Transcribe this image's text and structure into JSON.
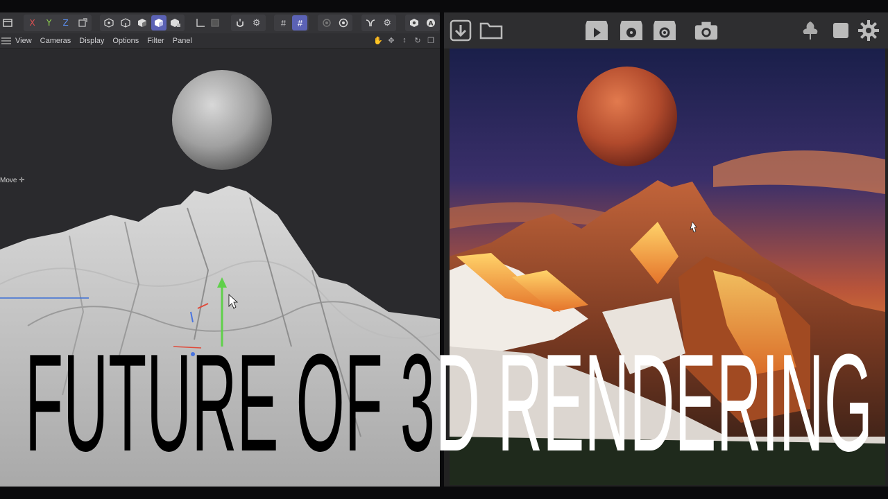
{
  "editor": {
    "toolbar": {
      "axis_x": "X",
      "axis_y": "Y",
      "axis_z": "Z",
      "icons": [
        "panel-icon",
        "coordinate-icon",
        "points-mode-icon",
        "edges-mode-icon",
        "polygons-mode-icon",
        "model-mode-icon",
        "texture-mode-icon",
        "workplane-icon",
        "snap-icon",
        "lock-icon",
        "gear-icon",
        "grid-icon",
        "grid-snap-icon",
        "solo-icon",
        "target-icon",
        "symmetry-icon",
        "settings-icon",
        "object-icon",
        "auto-icon"
      ]
    },
    "menu": {
      "items": [
        "View",
        "Cameras",
        "Display",
        "Options",
        "Filter",
        "Panel"
      ]
    },
    "viewport": {
      "tool_label": "Move"
    }
  },
  "render_window": {
    "toolbar_icons": [
      "download-icon",
      "folder-icon",
      "render-play-icon",
      "render-reel-icon",
      "render-settings-icon",
      "camera-icon",
      "tree-icon",
      "stop-icon",
      "gear-icon"
    ]
  },
  "headline": {
    "text": "FUTURE OF 3D RENDERING"
  },
  "colors": {
    "accent": "#5b62b5",
    "editor_bg": "#2b2b2e",
    "headline_dark": "#000000",
    "headline_light": "#ffffff"
  }
}
